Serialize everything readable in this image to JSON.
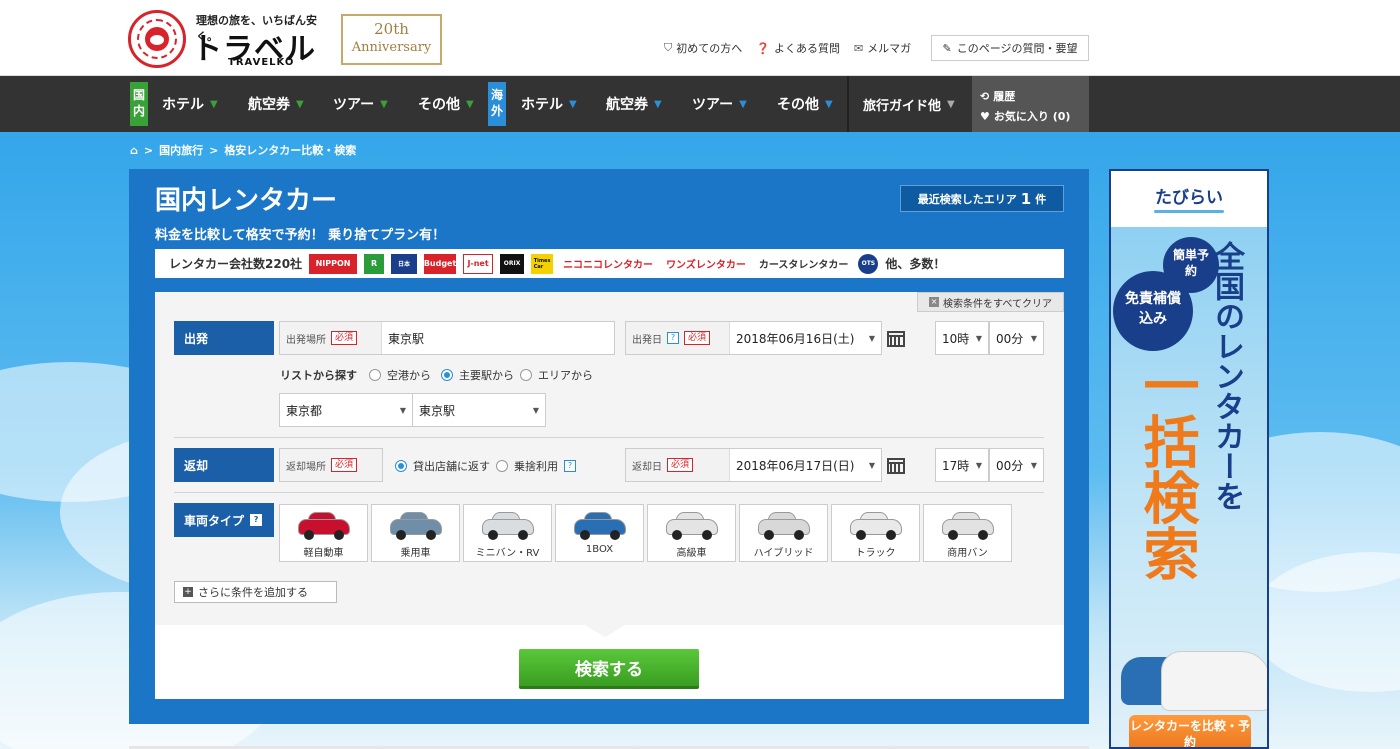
{
  "header": {
    "tagline": "理想の旅を、いちばん安く。",
    "logo_text": "トラベルコ",
    "logo_sub": "TRAVELKO",
    "anniv_line1": "20th",
    "anniv_line2": "Anniversary",
    "links": [
      {
        "label": "初めての方へ",
        "icon": "shield-icon"
      },
      {
        "label": "よくある質問",
        "icon": "question-icon"
      },
      {
        "label": "メルマガ",
        "icon": "mail-icon"
      }
    ],
    "feedback_label": "このページの質問・要望"
  },
  "nav": {
    "domestic_label": "国内",
    "international_label": "海外",
    "domestic_items": [
      "ホテル",
      "航空券",
      "ツアー",
      "その他"
    ],
    "international_items": [
      "ホテル",
      "航空券",
      "ツアー",
      "その他"
    ],
    "guide_label": "旅行ガイド他",
    "history_label": "履歴",
    "favorites_label": "お気に入り (0)"
  },
  "breadcrumb": [
    "国内旅行",
    "格安レンタカー比較・検索"
  ],
  "page": {
    "title": "国内レンタカー",
    "subtitle": "料金を比較して格安で予約！ 乗り捨てプラン有！",
    "recent_label": "最近検索したエリア",
    "recent_count": "1",
    "recent_unit": "件",
    "company_count_label": "レンタカー会社数220社",
    "company_logos": [
      "NIPPON",
      "R",
      "Budget",
      "J-net",
      "ORIX",
      "Times Car",
      "ニコニコレンタカー",
      "ワンズレンタカー",
      "カースタレンタカー",
      "OTS"
    ],
    "company_more": "他、多数！"
  },
  "form": {
    "clear_label": "検索条件をすべてクリア",
    "departure_label": "出発",
    "departure_place_label": "出発場所",
    "required": "必須",
    "departure_place_value": "東京駅",
    "departure_date_label": "出発日",
    "departure_date_value": "2018年06月16日(土)",
    "departure_hour": "10時",
    "departure_min": "00分",
    "list_search_label": "リストから探す",
    "list_options": [
      "空港から",
      "主要駅から",
      "エリアから"
    ],
    "list_selected": 1,
    "prefecture": "東京都",
    "station": "東京駅",
    "return_label": "返却",
    "return_place_label": "返却場所",
    "return_options": [
      "貸出店舗に返す",
      "乗捨利用"
    ],
    "return_date_label": "返却日",
    "return_date_value": "2018年06月17日(日)",
    "return_hour": "17時",
    "return_min": "00分",
    "car_type_label": "車両タイプ",
    "car_types": [
      {
        "label": "軽自動車",
        "color": "#c8102e"
      },
      {
        "label": "乗用車",
        "color": "#6f8ea8"
      },
      {
        "label": "ミニバン・RV",
        "color": "#d9dde0"
      },
      {
        "label": "1BOX",
        "color": "#2a6fb3"
      },
      {
        "label": "高級車",
        "color": "#e4e4e4"
      },
      {
        "label": "ハイブリッド",
        "color": "#d8d8d8"
      },
      {
        "label": "トラック",
        "color": "#e9e9e9"
      },
      {
        "label": "商用バン",
        "color": "#e2e2e2"
      }
    ],
    "add_condition_label": "さらに条件を追加する",
    "search_label": "検索する"
  },
  "ad": {
    "brand": "たびらい",
    "badge1": "簡単予約",
    "badge2": "免責補償込み",
    "headline": "全国のレンタカーを",
    "headline_big": "一括検索",
    "cta": "レンタカーを比較・予約"
  }
}
